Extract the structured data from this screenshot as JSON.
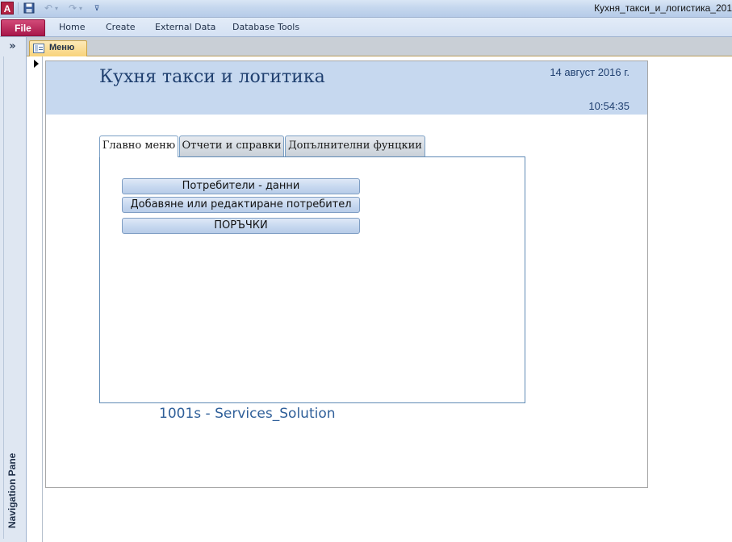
{
  "titlebar": {
    "app_icon": "A",
    "window_title": "Кухня_такси_и_логистика_201"
  },
  "quick_access": {
    "save_icon": "save-icon",
    "undo_icon": "undo-icon",
    "redo_icon": "redo-icon",
    "customize_icon": "customize-icon"
  },
  "ribbon": {
    "file_label": "File",
    "tabs": [
      "Home",
      "Create",
      "External Data",
      "Database Tools"
    ]
  },
  "navigation_pane": {
    "toggle_label": "»",
    "label": "Navigation Pane"
  },
  "document_tab": {
    "label": "Меню"
  },
  "form": {
    "title": "Кухня такси и логитика",
    "date": "14 август 2016 г.",
    "time": "10:54:35",
    "tabs": [
      "Главно меню",
      "Отчети и справки",
      "Допълнителни фунцкии"
    ],
    "active_tab": "Главно меню",
    "buttons": [
      "Потребители - данни",
      "Добавяне или редактиране потребител",
      "ПОРЪЧКИ"
    ],
    "footer": "1001s - Services_Solution"
  },
  "colors": {
    "header_bg": "#c6d8ef",
    "title_text": "#1f3f6f",
    "file_tab": "#b01e50",
    "footer_text": "#2f5f99"
  }
}
